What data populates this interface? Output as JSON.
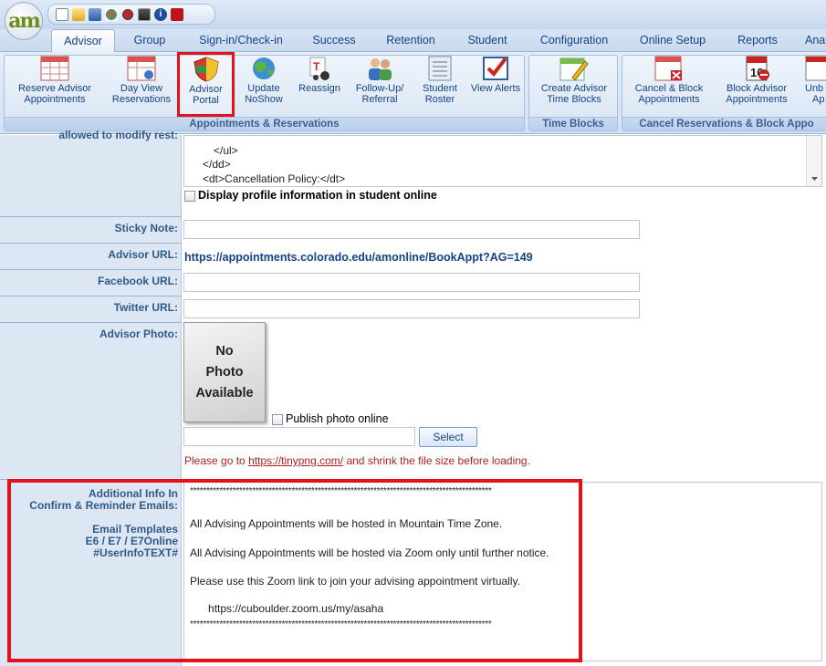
{
  "app": {
    "logo_text": "am",
    "quick_toolbar_icons": [
      "notepad-icon",
      "folder-icon",
      "building-icon",
      "network-icon",
      "scissors-icon",
      "contacts-icon",
      "info-icon",
      "pdf-icon"
    ]
  },
  "tabs": [
    "Advisor",
    "Group",
    "Sign-in/Check-in",
    "Success",
    "Retention",
    "Student",
    "Configuration",
    "Online Setup",
    "Reports",
    "Ana"
  ],
  "ribbon": {
    "groups": [
      {
        "label": "Appointments & Reservations"
      },
      {
        "label": "Time Blocks"
      },
      {
        "label": "Cancel Reservations & Block Appo"
      }
    ],
    "buttons": [
      {
        "line1": "Reserve Advisor",
        "line2": "Appointments",
        "icon": "calendar-grid-icon"
      },
      {
        "line1": "Day View",
        "line2": "Reservations",
        "icon": "calendar-gear-icon"
      },
      {
        "line1": "Advisor",
        "line2": "Portal",
        "icon": "shield-icon"
      },
      {
        "line1": "Update",
        "line2": "NoShow",
        "icon": "globe-icon"
      },
      {
        "line1": "Reassign",
        "line2": "",
        "icon": "reassign-icon"
      },
      {
        "line1": "Follow-Up/",
        "line2": "Referral",
        "icon": "people-icon"
      },
      {
        "line1": "Student",
        "line2": "Roster",
        "icon": "roster-icon"
      },
      {
        "line1": "View Alerts",
        "line2": "",
        "icon": "checkbox-alert-icon"
      },
      {
        "line1": "Create Advisor",
        "line2": "Time Blocks",
        "icon": "calendar-pencil-icon"
      },
      {
        "line1": "Cancel & Block",
        "line2": "Appointments",
        "icon": "calendar-cancel-icon"
      },
      {
        "line1": "Block Advisor",
        "line2": "Appointments",
        "icon": "calendar-block-icon"
      },
      {
        "line1": "Unb",
        "line2": "Ap",
        "icon": "unblock-icon"
      }
    ]
  },
  "form": {
    "partial_label": "allowed to modify rest:",
    "profile_lines": [
      "</ul>",
      "</dd>",
      "<dt>Cancellation Policy:</dt>"
    ],
    "display_profile_label": "Display profile information in student online",
    "sticky_note_label": "Sticky Note:",
    "sticky_note_value": "",
    "advisor_url_label": "Advisor URL:",
    "advisor_url_value": "https://appointments.colorado.edu/amonline/BookAppt?AG=149",
    "facebook_label": "Facebook URL:",
    "facebook_value": "",
    "twitter_label": "Twitter URL:",
    "twitter_value": "",
    "photo_label": "Advisor Photo:",
    "photo_placeholder": [
      "No",
      "Photo",
      "Available"
    ],
    "publish_photo_label": "Publish photo online",
    "file_value": "",
    "select_label": "Select",
    "tinypng_prefix": "Please go to ",
    "tinypng_link": "https://tinypng.com/",
    "tinypng_suffix": " and shrink the file size before loading.",
    "additional_info_label_1": "Additional Info In",
    "additional_info_label_2": "Confirm & Reminder Emails:",
    "templates_label_1": "Email Templates",
    "templates_label_2": "E6 / E7 / E7Online",
    "templates_label_3": "#UserInfoTEXT#",
    "email_stars": "********************************************************************************************",
    "email_line_1": "All Advising Appointments will be hosted in Mountain Time Zone.",
    "email_line_2": "All Advising Appointments will be hosted via Zoom only until further notice.",
    "email_line_3": "Please use this Zoom link to join your advising appointment virtually.",
    "email_link_1": "https",
    "email_link_2": "://",
    "email_link_3": "cuboulder.zoom.us",
    "email_link_4": "/my/",
    "email_link_5": "asaha"
  },
  "colors": {
    "accent": "#15428b",
    "label_text": "#2f5a8c",
    "highlight": "#e3121b",
    "warning_text": "#b22222"
  }
}
